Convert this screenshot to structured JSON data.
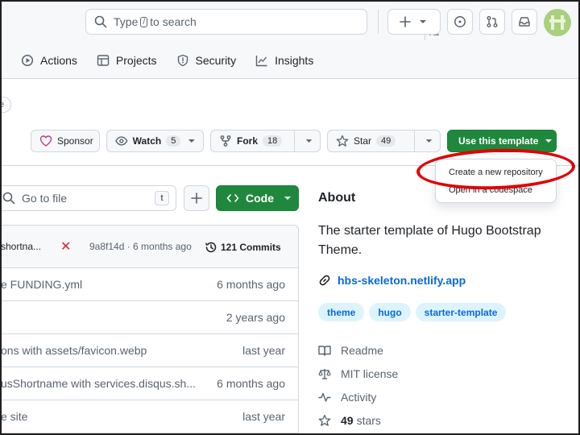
{
  "header": {
    "search_prefix": "Type",
    "search_key": "/",
    "search_suffix": "to search"
  },
  "tabs": [
    {
      "label": "Actions"
    },
    {
      "label": "Projects"
    },
    {
      "label": "Security"
    },
    {
      "label": "Insights"
    }
  ],
  "repo": {
    "topic_fragment": "e",
    "sponsor_label": "Sponsor",
    "watch_label": "Watch",
    "watch_count": "5",
    "fork_label": "Fork",
    "fork_count": "18",
    "star_label": "Star",
    "star_count": "49",
    "template_label": "Use this template"
  },
  "template_menu": {
    "items": [
      {
        "label": "Create a new repository"
      },
      {
        "label": "Open in a codespace"
      }
    ]
  },
  "files": {
    "goto_placeholder": "Go to file",
    "goto_key": "t",
    "code_label": "Code",
    "commit": {
      "message": "shortna...",
      "status": "✕",
      "meta": "9a8f14d · 6 months ago",
      "count_label": "121 Commits"
    },
    "rows": [
      {
        "message": "e FUNDING.yml",
        "age": "6 months ago"
      },
      {
        "message": "",
        "age": "2 years ago"
      },
      {
        "message": "ons with assets/favicon.webp",
        "age": "last year"
      },
      {
        "message": "usShortname with services.disqus.sh...",
        "age": "6 months ago"
      },
      {
        "message": "e site",
        "age": "last year"
      }
    ]
  },
  "about": {
    "title": "About",
    "description": "The starter template of Hugo Bootstrap Theme.",
    "link": "hbs-skeleton.netlify.app",
    "topics": [
      {
        "label": "theme"
      },
      {
        "label": "hugo"
      },
      {
        "label": "starter-template"
      }
    ],
    "readme": "Readme",
    "license": "MIT license",
    "activity": "Activity",
    "stars_count": "49",
    "stars_label": "stars"
  },
  "colors": {
    "primary_green": "#1f883d",
    "link_blue": "#0969da",
    "annotation_red": "#e00000",
    "avatar_green": "#a8d07e"
  }
}
